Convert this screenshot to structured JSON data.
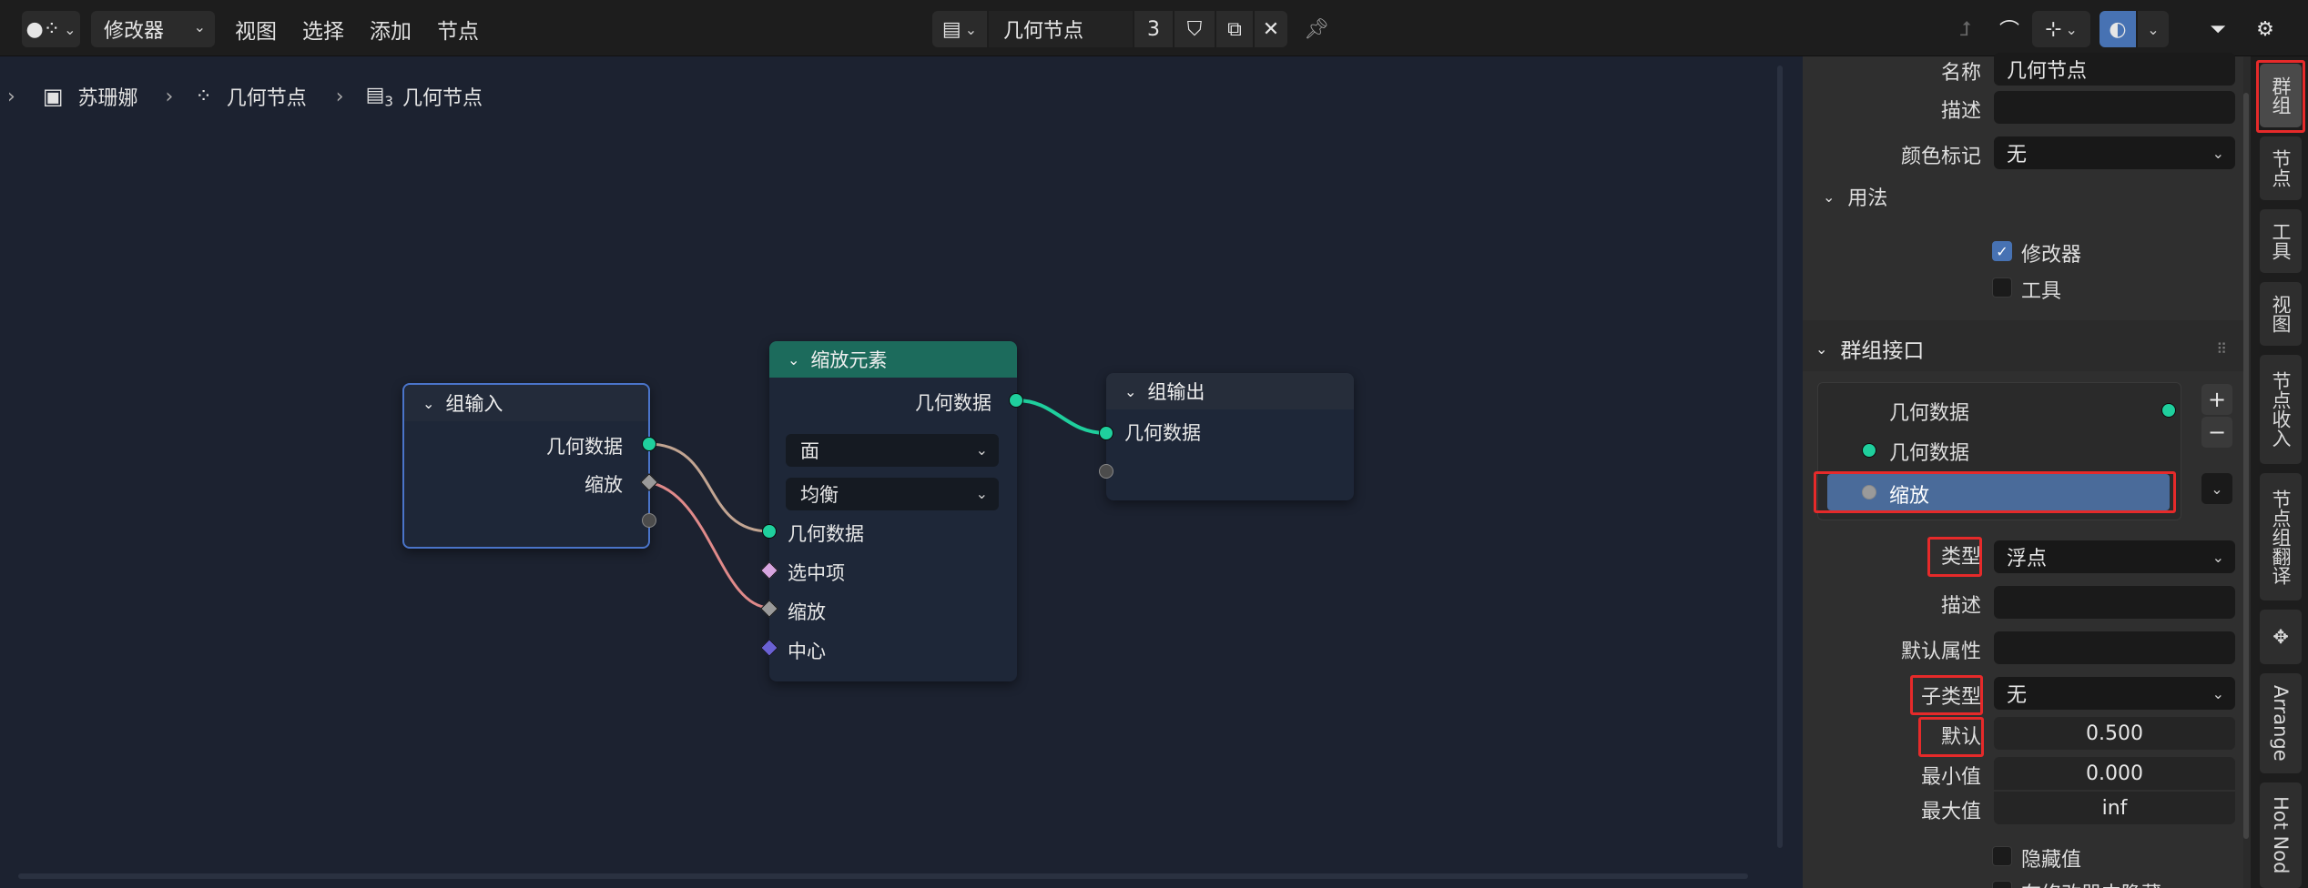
{
  "header": {
    "editor_type_icon": "geometry-nodes-icon",
    "mode_label": "修改器",
    "menus": [
      "视图",
      "选择",
      "添加",
      "节点"
    ],
    "nodetree_name": "几何节点",
    "user_count": "3"
  },
  "breadcrumb": {
    "object": "苏珊娜",
    "modifier": "几何节点",
    "nodegroup": "几何节点",
    "nodegroup_users": "3"
  },
  "nodes": {
    "group_input": {
      "title": "组输入",
      "outputs": [
        "几何数据",
        "缩放"
      ]
    },
    "scale_elements": {
      "title": "缩放元素",
      "output": "几何数据",
      "domain": "面",
      "mode": "均衡",
      "inputs": [
        "几何数据",
        "选中项",
        "缩放",
        "中心"
      ]
    },
    "group_output": {
      "title": "组输出",
      "inputs": [
        "几何数据"
      ]
    }
  },
  "panel": {
    "name_label": "名称",
    "name_value": "几何节点",
    "desc_label": "描述",
    "desc_value": "",
    "color_label": "颜色标记",
    "color_value": "无",
    "usage_title": "用法",
    "usage_modifier": "修改器",
    "usage_tool": "工具",
    "interface_title": "群组接口",
    "interface_items": [
      "几何数据",
      "几何数据",
      "缩放"
    ],
    "type_label": "类型",
    "type_value": "浮点",
    "item_desc_label": "描述",
    "default_attr_label": "默认属性",
    "subtype_label": "子类型",
    "subtype_value": "无",
    "default_label": "默认",
    "default_value": "0.500",
    "min_label": "最小值",
    "min_value": "0.000",
    "max_label": "最大值",
    "max_value": "inf",
    "hide_value_label": "隐藏值",
    "hide_in_modifier_label": "在修改器中隐藏"
  },
  "tabs": [
    "群组",
    "节点",
    "工具",
    "视图",
    "节点收入",
    "节点组翻译",
    "Arrange",
    "Hot Nod"
  ],
  "colors": {
    "accent_blue": "#4772b3",
    "geometry_socket": "#1fcf9d",
    "scale_header": "#1c6b5c",
    "highlight_red": "#e62a2a"
  }
}
